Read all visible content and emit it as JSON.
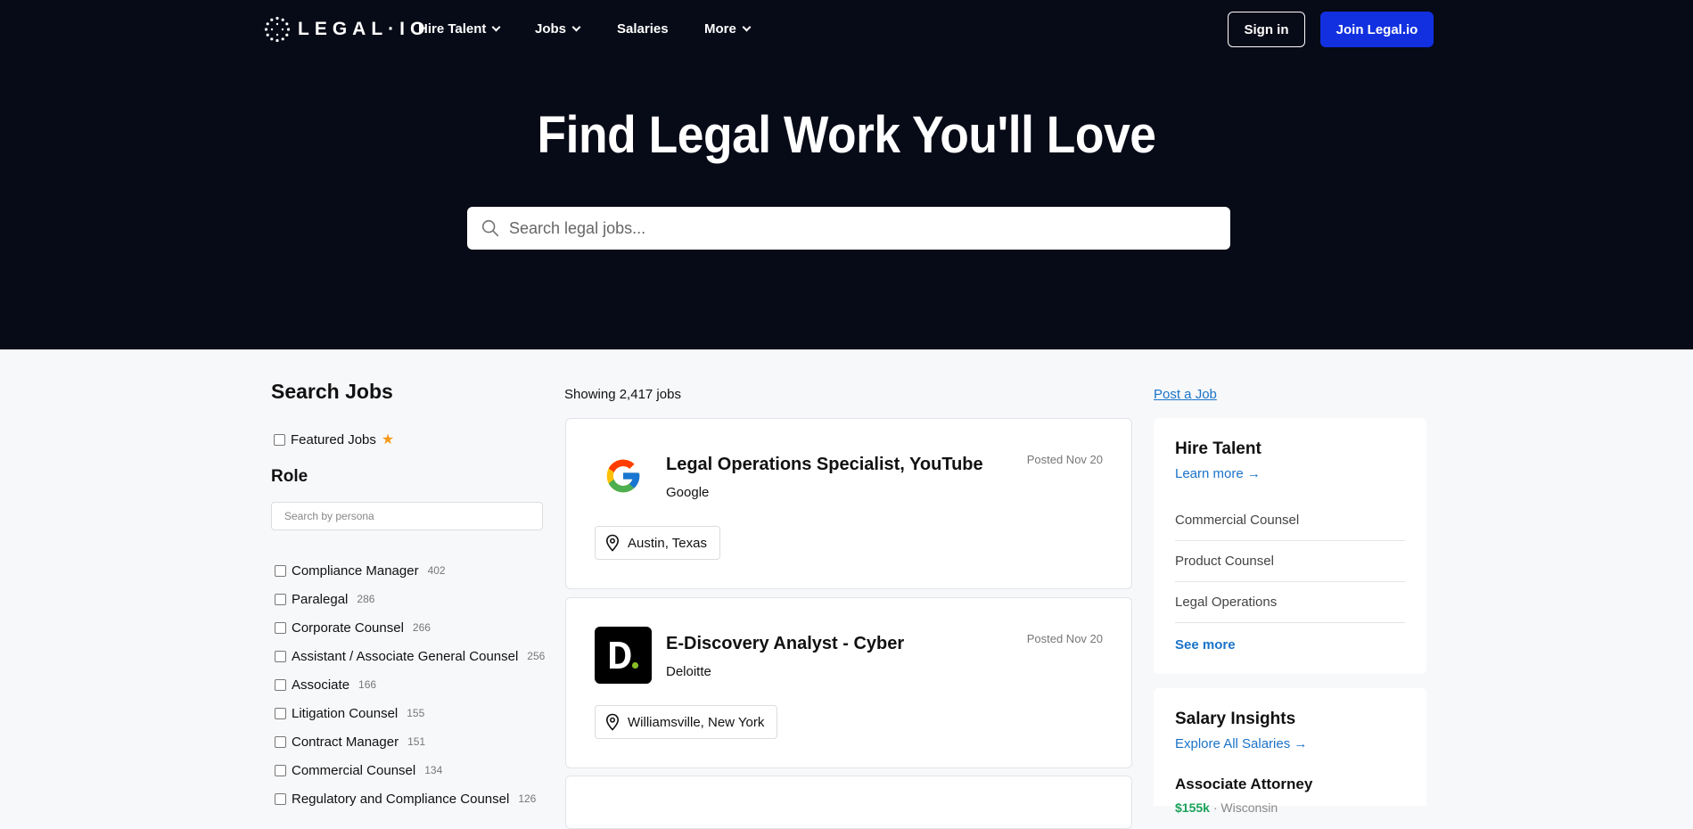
{
  "nav": {
    "logo_text": "LEGAL·IO",
    "items": [
      {
        "label": "Hire Talent",
        "dropdown": true
      },
      {
        "label": "Jobs",
        "dropdown": true
      },
      {
        "label": "Salaries",
        "dropdown": false
      },
      {
        "label": "More",
        "dropdown": true
      }
    ],
    "sign_in": "Sign in",
    "join": "Join Legal.io"
  },
  "hero": {
    "title": "Find Legal Work You'll Love",
    "search_placeholder": "Search legal jobs..."
  },
  "sidebar": {
    "title": "Search Jobs",
    "featured_label": "Featured Jobs",
    "role_title": "Role",
    "persona_placeholder": "Search by persona",
    "roles": [
      {
        "label": "Compliance Manager",
        "count": "402"
      },
      {
        "label": "Paralegal",
        "count": "286"
      },
      {
        "label": "Corporate Counsel",
        "count": "266"
      },
      {
        "label": "Assistant / Associate General Counsel",
        "count": "256"
      },
      {
        "label": "Associate",
        "count": "166"
      },
      {
        "label": "Litigation Counsel",
        "count": "155"
      },
      {
        "label": "Contract Manager",
        "count": "151"
      },
      {
        "label": "Commercial Counsel",
        "count": "134"
      },
      {
        "label": "Regulatory and Compliance Counsel",
        "count": "126"
      }
    ]
  },
  "results": {
    "showing_prefix": "Showing ",
    "showing_count": "2,417",
    "showing_suffix": " jobs",
    "jobs": [
      {
        "title": "Legal Operations Specialist, YouTube",
        "company": "Google",
        "posted": "Posted Nov 20",
        "location": "Austin, Texas"
      },
      {
        "title": "E-Discovery Analyst - Cyber",
        "company": "Deloitte",
        "posted": "Posted Nov 20",
        "location": "Williamsville, New York"
      }
    ]
  },
  "right": {
    "post_job": "Post a Job",
    "hire": {
      "title": "Hire Talent",
      "link": "Learn more →",
      "items": [
        "Commercial Counsel",
        "Product Counsel",
        "Legal Operations"
      ],
      "see_more": "See more"
    },
    "salary": {
      "title": "Salary Insights",
      "link": "Explore All Salaries →",
      "role": "Associate Attorney",
      "amount": "$155k",
      "location": "Wisconsin"
    }
  },
  "colors": {
    "hero_bg": "#070a17",
    "join_button": "#1230e0",
    "link": "#1a73c8",
    "star": "#f59a1b"
  }
}
